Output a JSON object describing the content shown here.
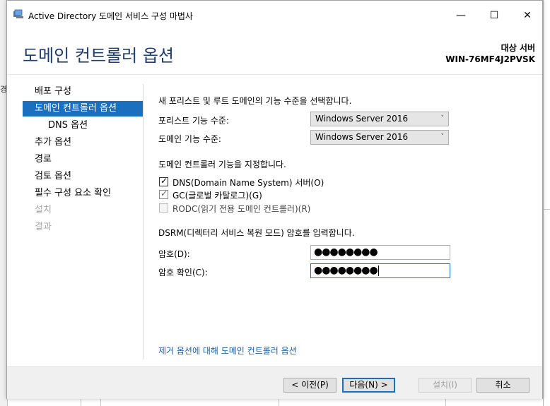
{
  "window": {
    "title": "Active Directory 도메인 서비스 구성 마법사",
    "minimize_glyph": "—",
    "maximize_glyph": "☐",
    "close_glyph": "✕"
  },
  "header": {
    "title": "도메인 컨트롤러 옵션",
    "target_label": "대상 서버",
    "target_server": "WIN-76MF4J2PVSK"
  },
  "background": {
    "left_text": "경"
  },
  "nav": {
    "items": [
      {
        "label": "배포 구성",
        "state": "normal"
      },
      {
        "label": "도메인 컨트롤러 옵션",
        "state": "active"
      },
      {
        "label": "DNS 옵션",
        "state": "sub"
      },
      {
        "label": "추가 옵션",
        "state": "normal"
      },
      {
        "label": "경로",
        "state": "normal"
      },
      {
        "label": "검토 옵션",
        "state": "normal"
      },
      {
        "label": "필수 구성 요소 확인",
        "state": "normal"
      },
      {
        "label": "설치",
        "state": "disabled"
      },
      {
        "label": "결과",
        "state": "disabled"
      }
    ]
  },
  "content": {
    "functional_level_intro": "새 포리스트 및 루트 도메인의 기능 수준을 선택합니다.",
    "forest_level_label": "포리스트 기능 수준:",
    "forest_level_value": "Windows Server 2016",
    "domain_level_label": "도메인 기능 수준:",
    "domain_level_value": "Windows Server 2016",
    "capabilities_intro": "도메인 컨트롤러 기능을 지정합니다.",
    "dns_label": "DNS(Domain Name System) 서버(O)",
    "gc_label": "GC(글로벌 카탈로그)(G)",
    "rodc_label": "RODC(읽기 전용 도메인 컨트롤러)(R)",
    "check_glyph": "✓",
    "dsrm_intro": "DSRM(디렉터리 서비스 복원 모드) 암호를 입력합니다.",
    "password_label": "암호(D):",
    "password_value": "●●●●●●●●",
    "confirm_label": "암호 확인(C):",
    "confirm_value": "●●●●●●●●",
    "more_link": "제거 옵션에 대해 도메인 컨트롤러 옵션",
    "dropdown_arrow": "˅"
  },
  "footer": {
    "prev": "< 이전(P)",
    "next": "다음(N) >",
    "install": "설치(I)",
    "cancel": "취소"
  },
  "colors": {
    "accent": "#1a6fbf",
    "title": "#1e3d6e",
    "link": "#1a5fa8"
  }
}
